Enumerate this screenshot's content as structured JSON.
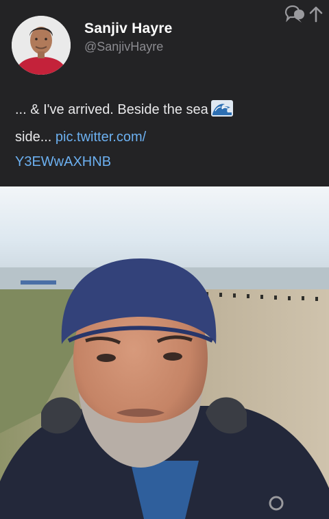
{
  "tweet": {
    "author": {
      "display_name": "Sanjiv Hayre",
      "handle": "@SanjivHayre"
    },
    "text": {
      "part1": "... & I've arrived. Beside the sea",
      "emoji": "water-wave-emoji",
      "part2": "side...",
      "link_line1": "pic.twitter.com/",
      "link_line2": "Y3EWwAXHNB"
    }
  },
  "icons": {
    "retweet": "speech-bubbles-icon",
    "share": "up-arrow-icon",
    "photo_badge": "circle-badge-icon"
  },
  "colors": {
    "background": "#1f1f21",
    "header": "#232325",
    "link": "#6cb0f0",
    "name": "#ffffff",
    "handle": "#8b8b90"
  }
}
